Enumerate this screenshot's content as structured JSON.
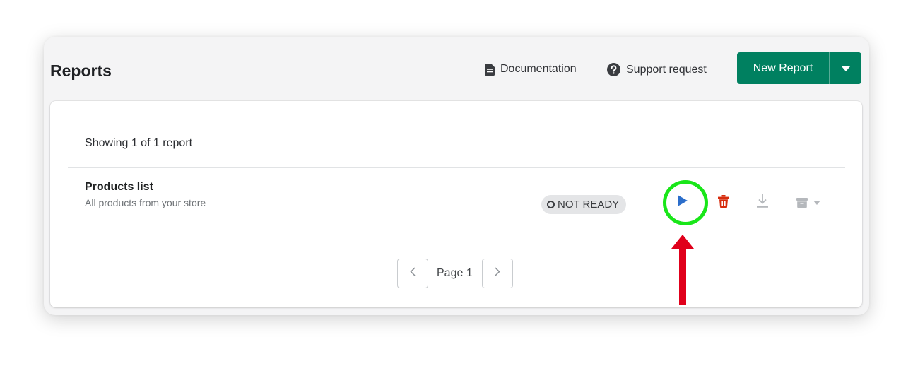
{
  "header": {
    "title": "Reports",
    "documentation_label": "Documentation",
    "support_label": "Support request",
    "new_report_label": "New Report"
  },
  "list": {
    "showing_text": "Showing 1 of 1 report",
    "reports": [
      {
        "name": "Products list",
        "description": "All products from your store",
        "status": "NOT READY"
      }
    ]
  },
  "pagination": {
    "page_label": "Page 1"
  },
  "icons": {
    "documentation": "document-icon",
    "support": "question-circle-icon",
    "new_report_menu": "caret-down-icon",
    "run": "play-icon",
    "delete": "trash-icon",
    "download": "download-icon",
    "archive": "archive-icon",
    "prev": "chevron-left-icon",
    "next": "chevron-right-icon"
  },
  "colors": {
    "primary": "#008060",
    "run": "#2c6ecb",
    "delete": "#d72c0d",
    "annotation_ring": "#19e619",
    "annotation_arrow": "#e0001b"
  }
}
